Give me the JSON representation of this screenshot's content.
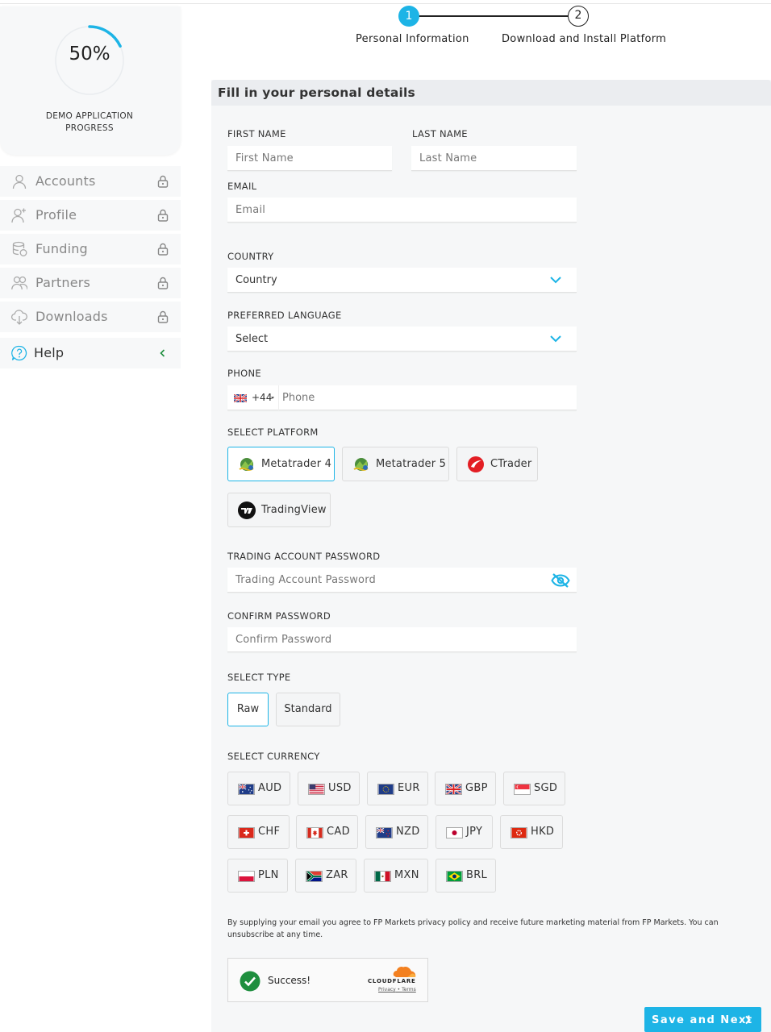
{
  "progress": {
    "percent_label": "50%",
    "percent_value": 0.5,
    "caption": "DEMO APPLICATION PROGRESS",
    "ring_color": "#1db4e6"
  },
  "sidebar": {
    "items": [
      {
        "label": "Accounts",
        "icon": "user-icon",
        "locked": true
      },
      {
        "label": "Profile",
        "icon": "user-plus-icon",
        "locked": true
      },
      {
        "label": "Funding",
        "icon": "coins-icon",
        "locked": true
      },
      {
        "label": "Partners",
        "icon": "users-icon",
        "locked": true
      },
      {
        "label": "Downloads",
        "icon": "cloud-download-icon",
        "locked": true
      },
      {
        "label": "Help",
        "icon": "help-icon",
        "locked": false
      }
    ]
  },
  "steps": [
    {
      "number": "1",
      "label": "Personal Information",
      "active": true
    },
    {
      "number": "2",
      "label": "Download and Install Platform",
      "active": false
    }
  ],
  "form": {
    "title": "Fill in your personal details",
    "first_name": {
      "label": "FIRST NAME",
      "placeholder": "First Name"
    },
    "last_name": {
      "label": "LAST NAME",
      "placeholder": "Last Name"
    },
    "email": {
      "label": "EMAIL",
      "placeholder": "Email"
    },
    "country": {
      "label": "COUNTRY",
      "value": "Country"
    },
    "language": {
      "label": "PREFERRED LANGUAGE",
      "value": "Select"
    },
    "phone": {
      "label": "PHONE",
      "code": "+44",
      "placeholder": "Phone"
    },
    "platform": {
      "label": "SELECT PLATFORM",
      "options": [
        {
          "label": "Metatrader 4",
          "icon": "metatrader-icon",
          "selected": true
        },
        {
          "label": "Metatrader 5",
          "icon": "metatrader-icon",
          "selected": false
        },
        {
          "label": "CTrader",
          "icon": "ctrader-icon",
          "selected": false
        },
        {
          "label": "TradingView",
          "icon": "tradingview-icon",
          "selected": false
        }
      ]
    },
    "trading_password": {
      "label": "TRADING ACCOUNT PASSWORD",
      "placeholder": "Trading Account Password"
    },
    "confirm_password": {
      "label": "CONFIRM PASSWORD",
      "placeholder": "Confirm Password"
    },
    "type": {
      "label": "SELECT TYPE",
      "options": [
        {
          "label": "Raw",
          "selected": true
        },
        {
          "label": "Standard",
          "selected": false
        }
      ]
    },
    "currency": {
      "label": "SELECT CURRENCY",
      "options": [
        "AUD",
        "USD",
        "EUR",
        "GBP",
        "SGD",
        "CHF",
        "CAD",
        "NZD",
        "JPY",
        "HKD",
        "PLN",
        "ZAR",
        "MXN",
        "BRL"
      ]
    },
    "consent": "By supplying your email you agree to FP Markets privacy policy and receive future marketing material from FP Markets. You can unsubscribe at any time.",
    "captcha": {
      "status": "Success!",
      "brand": "CLOUDFLARE",
      "privacy": "Privacy",
      "terms": "Terms"
    },
    "submit_label": "Save and Next"
  },
  "colors": {
    "accent": "#1db4e6",
    "panel_bg": "#f6f7f8",
    "success": "#1e8e3e",
    "cloudflare": "#f38020"
  }
}
